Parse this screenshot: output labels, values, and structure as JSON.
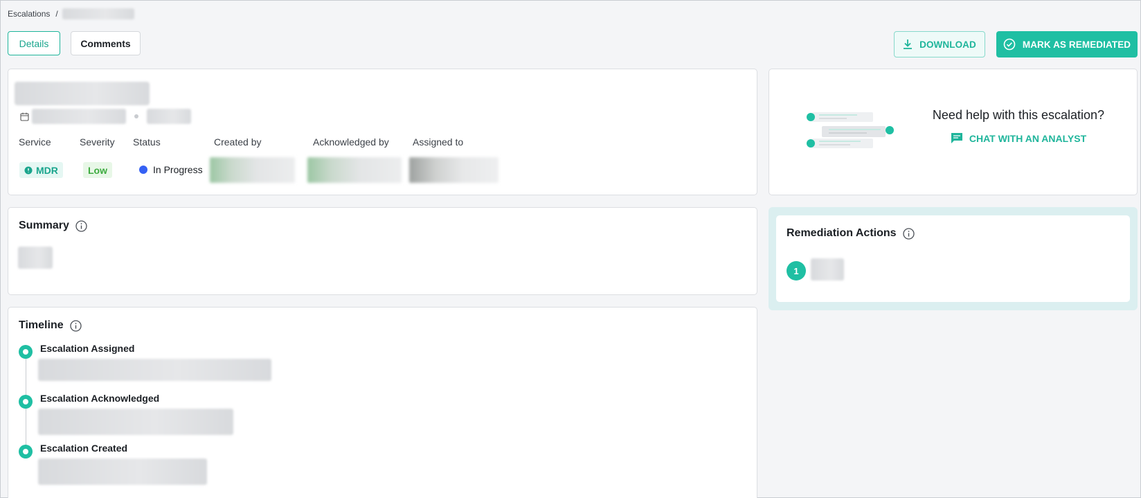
{
  "breadcrumb": {
    "root": "Escalations",
    "separator": "/"
  },
  "tabs": {
    "details": "Details",
    "comments": "Comments"
  },
  "actions": {
    "download": "DOWNLOAD",
    "remediate": "MARK AS REMEDIATED"
  },
  "header": {
    "labels": {
      "service": "Service",
      "severity": "Severity",
      "status": "Status",
      "created_by": "Created by",
      "acknowledged_by": "Acknowledged by",
      "assigned_to": "Assigned to"
    },
    "service_value": "MDR",
    "severity_value": "Low",
    "status_value": "In Progress"
  },
  "help": {
    "title": "Need help with this escalation?",
    "link": "CHAT WITH AN ANALYST"
  },
  "summary": {
    "title": "Summary"
  },
  "timeline": {
    "title": "Timeline",
    "events": [
      "Escalation Assigned",
      "Escalation Acknowledged",
      "Escalation Created"
    ]
  },
  "remediation": {
    "title": "Remediation Actions",
    "items": [
      {
        "index": "1"
      }
    ]
  },
  "colors": {
    "accent": "#1fbfa3",
    "status_in_progress": "#3561f4",
    "severity_low": "#3dab3f"
  }
}
